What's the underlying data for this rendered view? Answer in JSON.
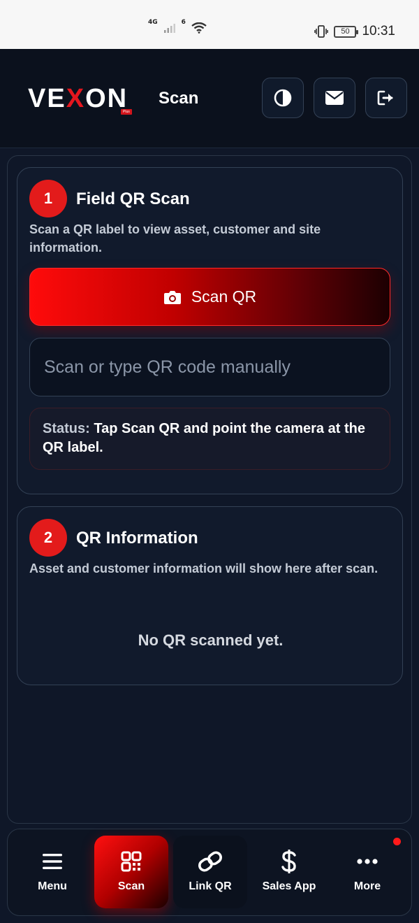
{
  "status_bar": {
    "network": "4G",
    "wifi_sub": "6",
    "battery": "50",
    "time": "10:31"
  },
  "header": {
    "logo_left": "VE",
    "logo_x": "X",
    "logo_right": "ON",
    "logo_badge": "Plus",
    "title": "Scan"
  },
  "card1": {
    "step": "1",
    "title": "Field QR Scan",
    "description": "Scan a QR label to view asset, customer and site information.",
    "scan_button_label": "Scan QR",
    "manual_input": {
      "value": "",
      "placeholder": "Scan or type QR code manually"
    },
    "status_label": "Status:",
    "status_text": "Tap Scan QR and point the camera at the QR label."
  },
  "card2": {
    "step": "2",
    "title": "QR Information",
    "description": "Asset and customer information will show here after scan.",
    "empty_message": "No QR scanned yet."
  },
  "bottom_nav": {
    "items": [
      {
        "label": "Menu",
        "icon": "menu-icon"
      },
      {
        "label": "Scan",
        "icon": "qr-code-icon"
      },
      {
        "label": "Link QR",
        "icon": "link-icon"
      },
      {
        "label": "Sales App",
        "icon": "dollar-icon"
      },
      {
        "label": "More",
        "icon": "more-dots-icon"
      }
    ]
  },
  "colors": {
    "accent": "#e31b1b",
    "background": "#0f1728",
    "card": "#111a2c"
  }
}
